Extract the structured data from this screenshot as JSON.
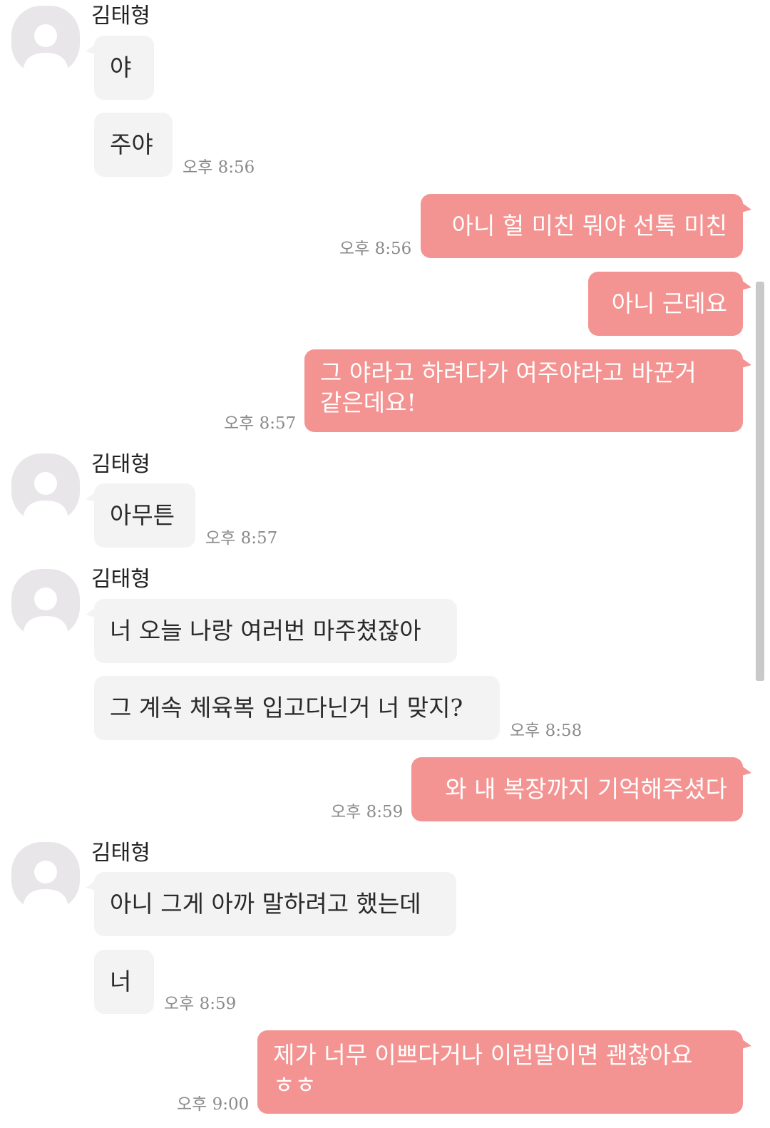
{
  "colors": {
    "incoming_bubble": "#f3f3f3",
    "outgoing_bubble": "#f49492",
    "avatar_bg": "#e8e6e9"
  },
  "icons": {
    "avatar": "default-profile-person-icon"
  },
  "messages": {
    "g1": {
      "sender": "김태형",
      "m1": "야",
      "m2": "주야",
      "time": "오후 8:56"
    },
    "o1": {
      "text": "아니 헐 미친 뭐야 선톡 미친",
      "time": "오후 8:56"
    },
    "o2": {
      "text": "아니 근데요"
    },
    "o3": {
      "line1": "그 야라고 하려다가 여주야라고 바꾼거",
      "line2": "같은데요!",
      "time": "오후 8:57"
    },
    "g2": {
      "sender": "김태형",
      "m1": "아무튼",
      "time": "오후 8:57"
    },
    "g3": {
      "sender": "김태형",
      "m1": "너 오늘 나랑 여러번 마주쳤잖아",
      "m2": "그 계속 체육복 입고다닌거 너 맞지?",
      "time": "오후 8:58"
    },
    "o4": {
      "text": "와 내 복장까지 기억해주셨다",
      "time": "오후 8:59"
    },
    "g4": {
      "sender": "김태형",
      "m1": "아니 그게 아까 말하려고 했는데",
      "m2": "너",
      "time": "오후 8:59"
    },
    "o5": {
      "line1": "제가 너무 이쁘다거나 이런말이면 괜찮아요",
      "line2": "ㅎㅎ",
      "time": "오후 9:00"
    }
  }
}
